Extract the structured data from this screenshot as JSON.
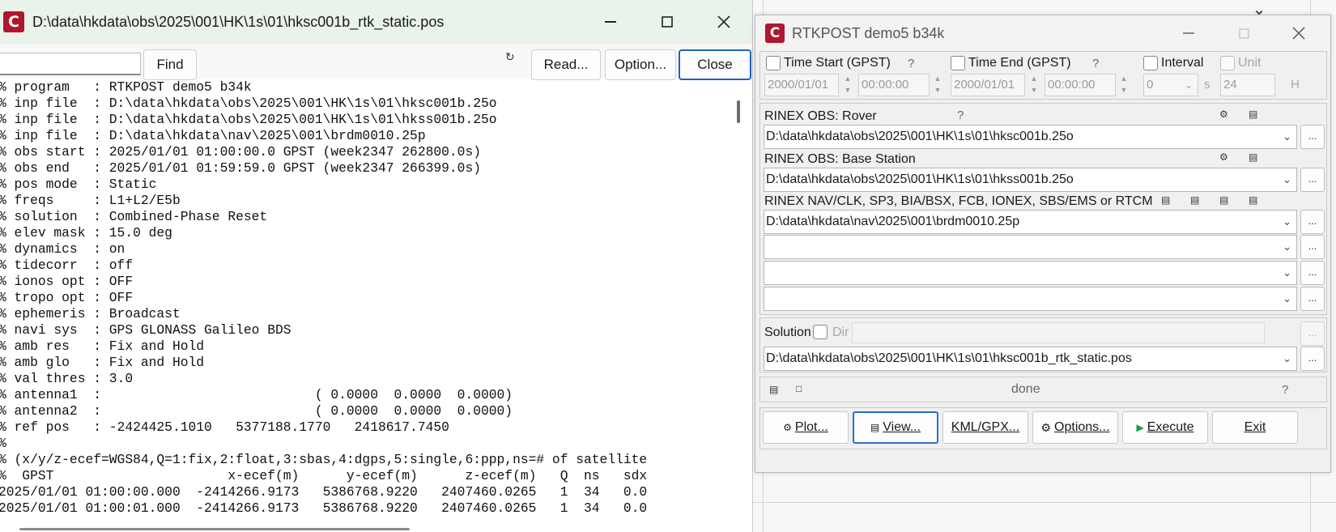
{
  "viewer": {
    "title": "D:\\data\\hkdata\\obs\\2025\\001\\HK\\1s\\01\\hksc001b_rtk_static.pos",
    "app_icon": "C",
    "find_label": "Find",
    "read_label": "Read...",
    "option_label": "Option...",
    "close_label": "Close",
    "lines": [
      "% program   : RTKPOST demo5 b34k",
      "% inp file  : D:\\data\\hkdata\\obs\\2025\\001\\HK\\1s\\01\\hksc001b.25o",
      "% inp file  : D:\\data\\hkdata\\obs\\2025\\001\\HK\\1s\\01\\hkss001b.25o",
      "% inp file  : D:\\data\\hkdata\\nav\\2025\\001\\brdm0010.25p",
      "% obs start : 2025/01/01 01:00:00.0 GPST (week2347 262800.0s)",
      "% obs end   : 2025/01/01 01:59:59.0 GPST (week2347 266399.0s)",
      "% pos mode  : Static",
      "% freqs     : L1+L2/E5b",
      "% solution  : Combined-Phase Reset",
      "% elev mask : 15.0 deg",
      "% dynamics  : on",
      "% tidecorr  : off",
      "% ionos opt : OFF",
      "% tropo opt : OFF",
      "% ephemeris : Broadcast",
      "% navi sys  : GPS GLONASS Galileo BDS",
      "% amb res   : Fix and Hold",
      "% amb glo   : Fix and Hold",
      "% val thres : 3.0",
      "% antenna1  :                           ( 0.0000  0.0000  0.0000)",
      "% antenna2  :                           ( 0.0000  0.0000  0.0000)",
      "% ref pos   : -2424425.1010   5377188.1770   2418617.7450",
      "%",
      "% (x/y/z-ecef=WGS84,Q=1:fix,2:float,3:sbas,4:dgps,5:single,6:ppp,ns=# of satellite",
      "%  GPST                      x-ecef(m)      y-ecef(m)      z-ecef(m)   Q  ns   sdx",
      "2025/01/01 01:00:00.000  -2414266.9173   5386768.9220   2407460.0265   1  34   0.0",
      "2025/01/01 01:00:01.000  -2414266.9173   5386768.9220   2407460.0265   1  34   0.0"
    ]
  },
  "rtk": {
    "title": "RTKPOST demo5 b34k",
    "app_icon": "C",
    "time_start_label": "Time Start (GPST)",
    "time_end_label": "Time End (GPST)",
    "interval_label": "Interval",
    "unit_label": "Unit",
    "question": "?",
    "start_date": "2000/01/01",
    "start_time": "00:00:00",
    "end_date": "2000/01/01",
    "end_time": "00:00:00",
    "interval_value": "0",
    "interval_unit": "s",
    "unit_value": "24",
    "unit_unit": "H",
    "rover_label": "RINEX OBS: Rover",
    "rover_path": "D:\\data\\hkdata\\obs\\2025\\001\\HK\\1s\\01\\hksc001b.25o",
    "base_label": "RINEX OBS: Base Station",
    "base_path": "D:\\data\\hkdata\\obs\\2025\\001\\HK\\1s\\01\\hkss001b.25o",
    "nav_label": "RINEX NAV/CLK, SP3, BIA/BSX, FCB, IONEX, SBS/EMS  or RTCM",
    "nav_path": "D:\\data\\hkdata\\nav\\2025\\001\\brdm0010.25p",
    "solution_label": "Solution",
    "dir_label": "Dir",
    "solution_path": "D:\\data\\hkdata\\obs\\2025\\001\\HK\\1s\\01\\hksc001b_rtk_static.pos",
    "status": "done",
    "browse": "...",
    "buttons": {
      "plot": "Plot...",
      "view": "View...",
      "kml": "KML/GPX...",
      "options": "Options...",
      "execute": "Execute",
      "exit": "Exit"
    }
  }
}
